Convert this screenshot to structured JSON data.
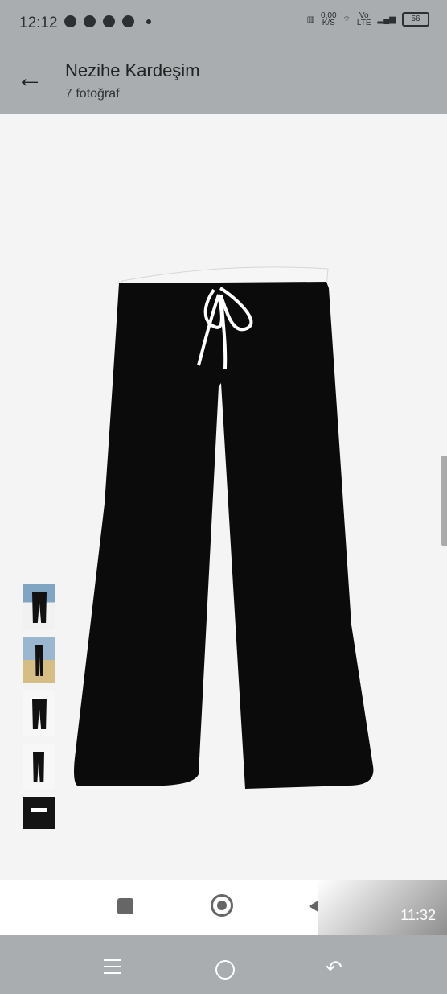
{
  "status_bar": {
    "time": "12:12",
    "network_speed": "0,00",
    "speed_unit": "K/S",
    "volte": "Vo",
    "lte": "LTE",
    "battery": "56"
  },
  "header": {
    "title": "Nezihe Kardeşim",
    "subtitle": "7 fotoğraf"
  },
  "viewer": {
    "thumbnails": [
      "thumb-1",
      "thumb-2",
      "thumb-3",
      "thumb-4",
      "thumb-5"
    ]
  },
  "navigation": {
    "time": "11:32"
  },
  "icons": {
    "back": "arrow-left-icon",
    "menu": "menu-icon",
    "home": "home-icon",
    "return": "return-icon"
  }
}
